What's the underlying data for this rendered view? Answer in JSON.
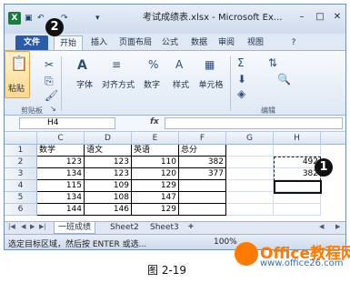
{
  "window": {
    "title": "考试成绩表.xlsx - Microsoft Ex...",
    "app_icon": "X",
    "qat_icons": [
      "save-icon",
      "undo-icon",
      "redo-icon",
      "customize-icon"
    ]
  },
  "tabs": [
    "文件",
    "开始",
    "插入",
    "页面布局",
    "公式",
    "数据",
    "审阅",
    "视图"
  ],
  "ribbon": {
    "paste_label": "粘贴",
    "clipboard_group": "剪贴板",
    "font_label": "字体",
    "align_label": "对齐方式",
    "number_label": "数字",
    "style_label": "样式",
    "cells_label": "单元格",
    "edit_group": "编辑"
  },
  "formula_bar": {
    "name_box": "H4",
    "fx": "fx",
    "formula": ""
  },
  "grid": {
    "columns": [
      "C",
      "D",
      "E",
      "F",
      "G",
      "H"
    ],
    "rows": [
      {
        "n": "1",
        "cells": [
          "数学",
          "语文",
          "英语",
          "总分",
          "",
          ""
        ]
      },
      {
        "n": "2",
        "cells": [
          "123",
          "123",
          "110",
          "382",
          "",
          "492"
        ]
      },
      {
        "n": "3",
        "cells": [
          "134",
          "123",
          "120",
          "377",
          "",
          "382"
        ]
      },
      {
        "n": "4",
        "cells": [
          "115",
          "109",
          "129",
          "",
          "",
          ""
        ]
      },
      {
        "n": "5",
        "cells": [
          "134",
          "108",
          "147",
          "",
          "",
          ""
        ]
      },
      {
        "n": "6",
        "cells": [
          "144",
          "146",
          "129",
          "",
          "",
          ""
        ]
      }
    ]
  },
  "sheets": [
    "一班成绩",
    "Sheet2",
    "Sheet3"
  ],
  "status": {
    "text": "选定目标区域，然后按 ENTER 或选...",
    "zoom": "100%"
  },
  "callouts": [
    "2",
    "1"
  ],
  "watermark": {
    "title": "Office教程网",
    "url": "www.office26.com"
  },
  "caption": "图 2-19",
  "colors": {
    "file_tab": "#2a5caa",
    "accent_orange": "#ff7a00",
    "accent_blue": "#2b6fc2"
  }
}
